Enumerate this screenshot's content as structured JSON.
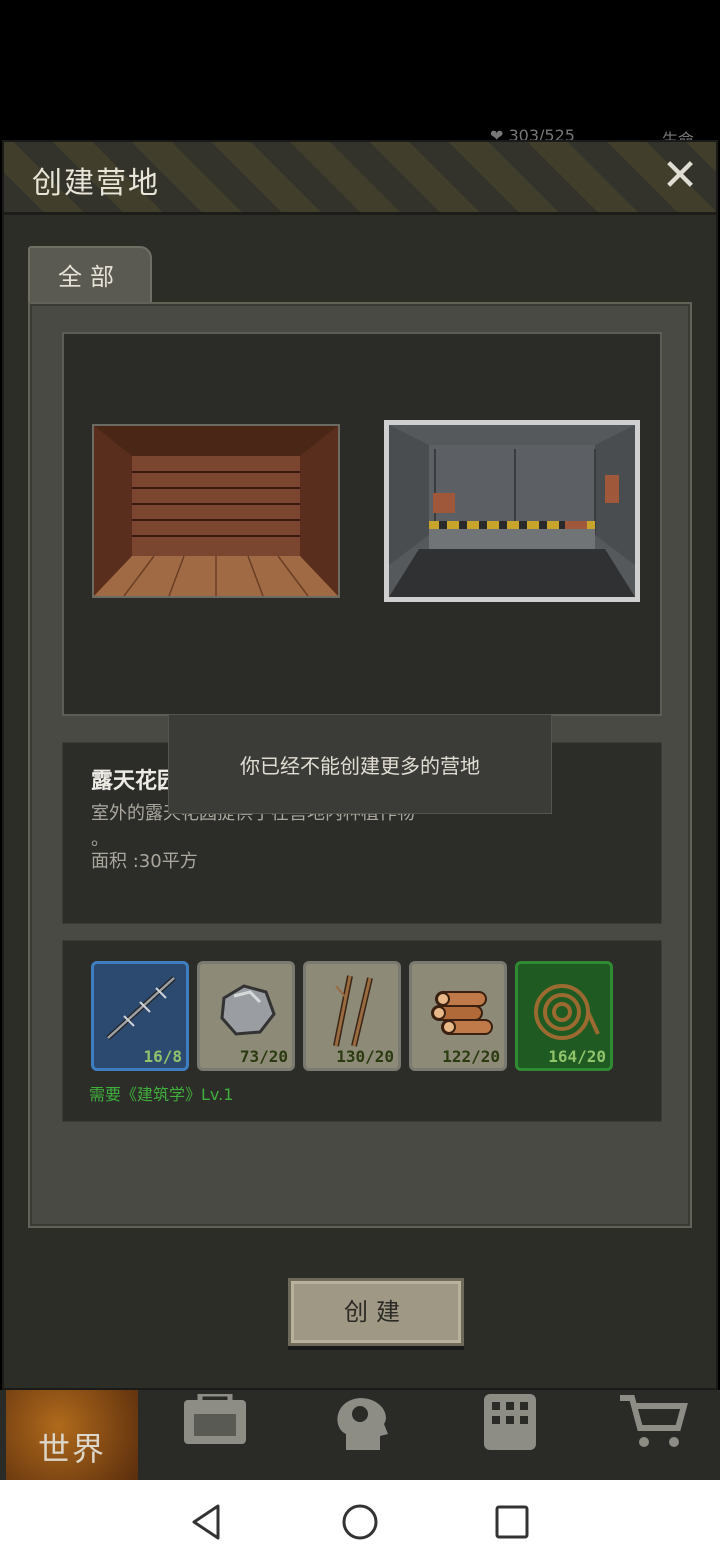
{
  "status_peek": {
    "left": "303/525",
    "right": "生命"
  },
  "dialog": {
    "title": "创建营地",
    "close_icon": "close-icon"
  },
  "tabs": [
    {
      "label": "全部"
    }
  ],
  "item": {
    "name": "露天花园",
    "description": "室外的露天花园提供了在营地内种植作物",
    "description_tail": "。",
    "area": "面积 :30平方"
  },
  "resources": [
    {
      "icon": "barbed-wire-icon",
      "count": "16/8",
      "style": "blue"
    },
    {
      "icon": "stone-icon",
      "count": "73/20",
      "style": "gray"
    },
    {
      "icon": "branches-icon",
      "count": "130/20",
      "style": "gray"
    },
    {
      "icon": "logs-icon",
      "count": "122/20",
      "style": "gray"
    },
    {
      "icon": "rope-coil-icon",
      "count": "164/20",
      "style": "green"
    }
  ],
  "requirement": "需要《建筑学》Lv.1",
  "toast": "你已经不能创建更多的营地",
  "create_button": "创建",
  "nav": {
    "world": "世界"
  },
  "colors": {
    "accent_green": "#3fae3c",
    "resource_blue": "#2c4a70",
    "resource_green": "#1f5a22"
  }
}
